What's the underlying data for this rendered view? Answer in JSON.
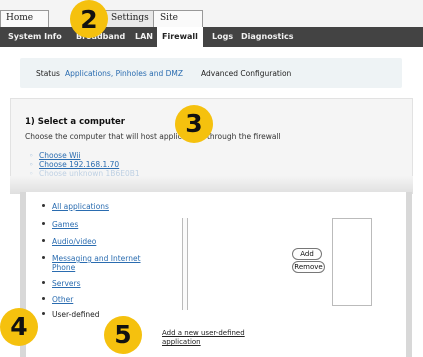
{
  "top_tabs": [
    {
      "label": "Home"
    },
    {
      "label": "Settings"
    },
    {
      "label": "Site Map"
    }
  ],
  "subnav": {
    "items": [
      {
        "label": "System Info"
      },
      {
        "label": "Broadband"
      },
      {
        "label": "LAN"
      },
      {
        "label": "Firewall"
      },
      {
        "label": "Logs"
      },
      {
        "label": "Diagnostics"
      }
    ],
    "active": "Firewall"
  },
  "section_links": [
    {
      "label": "Status"
    },
    {
      "label": "Applications, Pinholes and DMZ"
    },
    {
      "label": "Advanced Configuration"
    }
  ],
  "select_computer": {
    "title": "1) Select a computer",
    "description": "Choose the computer that will host applications through the firewall",
    "options": [
      {
        "label": "Choose Wii"
      },
      {
        "label": "Choose 192.168.1.70"
      },
      {
        "label": "Choose unknown 1B6E0B1"
      }
    ]
  },
  "applications": {
    "items": [
      {
        "label": "All applications"
      },
      {
        "label": "Games"
      },
      {
        "label": "Audio/video"
      },
      {
        "label": "Messaging and Internet Phone"
      },
      {
        "label": "Servers"
      },
      {
        "label": "Other"
      },
      {
        "label": "User-defined"
      }
    ],
    "add_button": "Add",
    "remove_button": "Remove",
    "add_user_defined_link": "Add a new user-defined application"
  },
  "callouts": [
    {
      "number": "2"
    },
    {
      "number": "3"
    },
    {
      "number": "4"
    },
    {
      "number": "5"
    }
  ],
  "colors": {
    "callout": "#f5c10e",
    "link": "#2a6cb0",
    "nav_dark": "#434343"
  }
}
